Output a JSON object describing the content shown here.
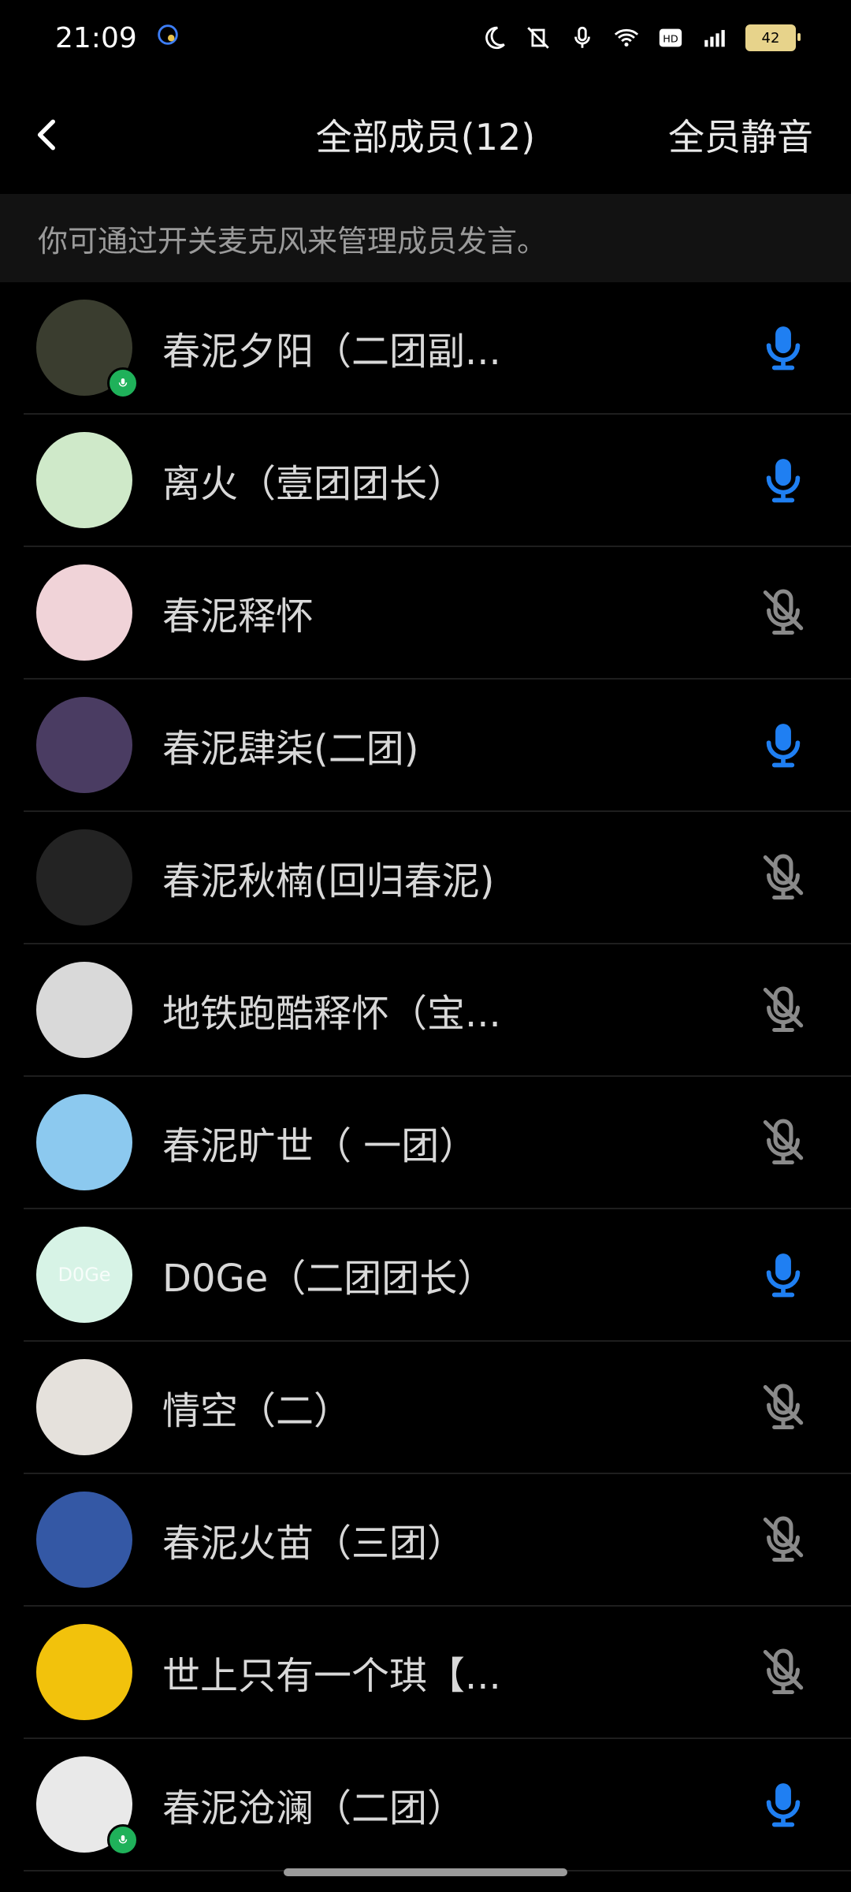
{
  "status": {
    "time": "21:09",
    "battery": "42"
  },
  "header": {
    "title": "全部成员(12)",
    "mute_all": "全员静音"
  },
  "hint": "你可通过开关麦克风来管理成员发言。",
  "colors": {
    "mic_on": "#1f7ff2",
    "mic_off": "#8a8a8a",
    "speaking_badge": "#1fb15a"
  },
  "members": [
    {
      "name": "春泥夕阳（二团副...",
      "mic": "on",
      "speaking": true,
      "avatar_color": "#3a3d2f"
    },
    {
      "name": "离火（壹团团长）",
      "mic": "on",
      "speaking": false,
      "avatar_color": "#cfe9c9"
    },
    {
      "name": "春泥释怀",
      "mic": "off",
      "speaking": false,
      "avatar_color": "#f0d3d8"
    },
    {
      "name": "春泥肆柒(二团)",
      "mic": "on",
      "speaking": false,
      "avatar_color": "#4a3c62"
    },
    {
      "name": "春泥秋楠(回归春泥)",
      "mic": "off",
      "speaking": false,
      "avatar_color": "#232323"
    },
    {
      "name": "地铁跑酷释怀（宝...",
      "mic": "off",
      "speaking": false,
      "avatar_color": "#d9d9d9"
    },
    {
      "name": "春泥旷世（ 一团）",
      "mic": "off",
      "speaking": false,
      "avatar_color": "#8cc9ef"
    },
    {
      "name": "D0Ge（二团团长）",
      "mic": "on",
      "speaking": false,
      "avatar_color": "#d7f3e6",
      "avatar_text": "D0Ge"
    },
    {
      "name": "情空（二）",
      "mic": "off",
      "speaking": false,
      "avatar_color": "#e5e1dc"
    },
    {
      "name": "春泥火苗（三团）",
      "mic": "off",
      "speaking": false,
      "avatar_color": "#3458a5"
    },
    {
      "name": "世上只有一个琪【...",
      "mic": "off",
      "speaking": false,
      "avatar_color": "#f2c20c"
    },
    {
      "name": "春泥沧澜（二团）",
      "mic": "on",
      "speaking": true,
      "avatar_color": "#e9e9e9"
    }
  ]
}
